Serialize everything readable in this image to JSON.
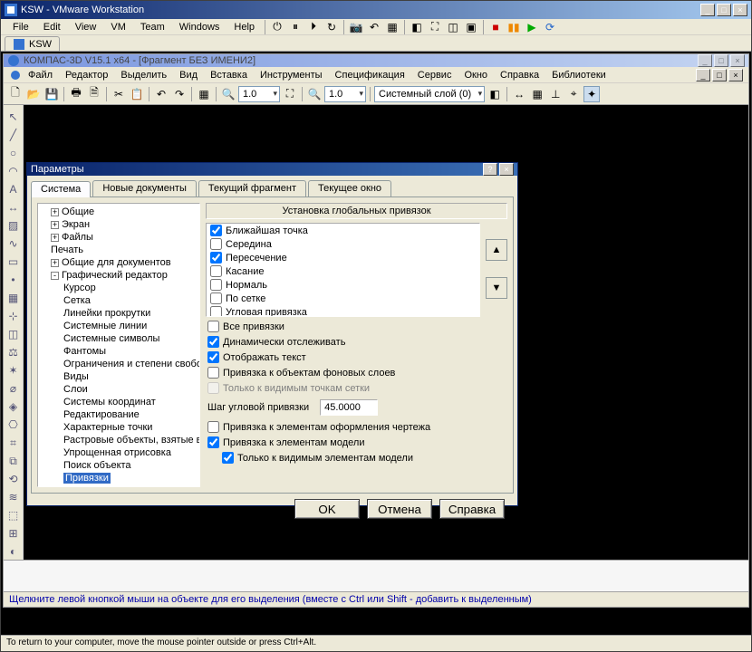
{
  "vmware": {
    "title": "KSW - VMware Workstation",
    "menu": [
      "File",
      "Edit",
      "View",
      "VM",
      "Team",
      "Windows",
      "Help"
    ],
    "tab": "KSW",
    "status": "To return to your computer, move the mouse pointer outside or press Ctrl+Alt."
  },
  "kompas": {
    "title": "КОМПАС-3D V15.1 x64 - [Фрагмент БЕЗ ИМЕНИ2]",
    "menu": [
      "Файл",
      "Редактор",
      "Выделить",
      "Вид",
      "Вставка",
      "Инструменты",
      "Спецификация",
      "Сервис",
      "Окно",
      "Справка",
      "Библиотеки"
    ],
    "zoom1": "1.0",
    "zoom2": "1.0",
    "layer": "Системный слой (0)",
    "hint": "Щелкните левой кнопкой мыши на объекте для его выделения (вместе с Ctrl или Shift - добавить к выделенным)"
  },
  "dialog": {
    "title": "Параметры",
    "tabs": [
      "Система",
      "Новые документы",
      "Текущий фрагмент",
      "Текущее окно"
    ],
    "active_tab": 0,
    "tree": {
      "roots": [
        {
          "label": "Общие",
          "exp": "+"
        },
        {
          "label": "Экран",
          "exp": "+"
        },
        {
          "label": "Файлы",
          "exp": "+"
        },
        {
          "label": "Печать"
        },
        {
          "label": "Общие для документов",
          "exp": "+"
        },
        {
          "label": "Графический редактор",
          "exp": "-",
          "children": [
            "Курсор",
            "Сетка",
            "Линейки прокрутки",
            "Системные линии",
            "Системные символы",
            "Фантомы",
            "Ограничения и степени свободы",
            "Виды",
            "Слои",
            "Системы координат",
            "Редактирование",
            "Характерные точки",
            "Растровые объекты, взятые в …",
            "Упрощенная отрисовка",
            "Поиск объекта",
            "Привязки"
          ],
          "selected": "Привязки"
        }
      ]
    },
    "group_title": "Установка глобальных привязок",
    "snap_list": [
      {
        "label": "Ближайшая точка",
        "checked": true
      },
      {
        "label": "Середина",
        "checked": false
      },
      {
        "label": "Пересечение",
        "checked": true
      },
      {
        "label": "Касание",
        "checked": false
      },
      {
        "label": "Нормаль",
        "checked": false
      },
      {
        "label": "По сетке",
        "checked": false
      },
      {
        "label": "Угловая привязка",
        "checked": false
      }
    ],
    "checks": {
      "all": {
        "label": "Все привязки",
        "checked": false
      },
      "dynamic": {
        "label": "Динамически отслеживать",
        "checked": true
      },
      "show_text": {
        "label": "Отображать текст",
        "checked": true
      },
      "bg_layers": {
        "label": "Привязка к объектам фоновых слоев",
        "checked": false
      },
      "grid_vis_only": {
        "label": "Только к видимым точкам сетки",
        "disabled": true
      },
      "drawing_decor": {
        "label": "Привязка к элементам оформления чертежа",
        "checked": false
      },
      "model_elems": {
        "label": "Привязка к элементам модели",
        "checked": true
      },
      "model_vis_only": {
        "label": "Только к видимым элементам модели",
        "checked": true
      }
    },
    "step": {
      "label": "Шаг угловой привязки",
      "value": "45.0000"
    },
    "buttons": {
      "ok": "OK",
      "cancel": "Отмена",
      "help": "Справка"
    }
  }
}
